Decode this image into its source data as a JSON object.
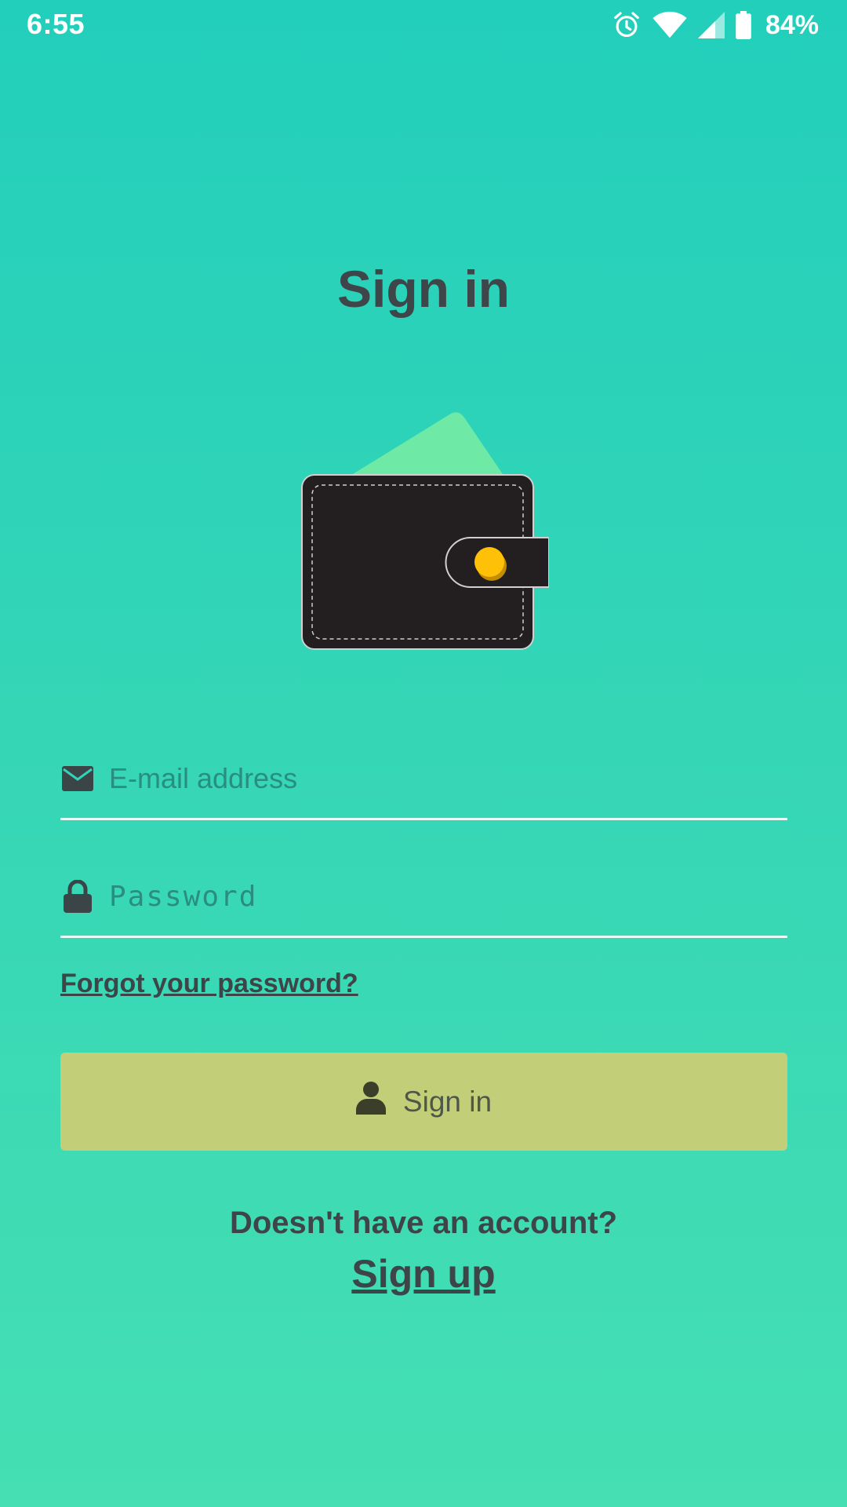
{
  "status_bar": {
    "time": "6:55",
    "battery": "84%",
    "icons": [
      "alarm-icon",
      "wifi-icon",
      "cell-signal-icon",
      "battery-icon"
    ]
  },
  "page": {
    "title": "Sign in",
    "illustration": "wallet-icon"
  },
  "form": {
    "email_placeholder": "E-mail address",
    "email_icon": "envelope-icon",
    "password_placeholder": "Password",
    "password_icon": "lock-icon",
    "forgot_password": "Forgot your password?",
    "signin_button": "Sign in",
    "signin_icon": "user-icon"
  },
  "footer": {
    "prompt": "Doesn't have an account?",
    "signup_link": "Sign up"
  },
  "colors": {
    "background_top": "#22cfbb",
    "background_bottom": "#45dfb3",
    "button": "#c3cf78",
    "text_dark": "#3e4649",
    "wallet": "#231f20",
    "wallet_button": "#ffc107",
    "card": "#6eeaa6"
  }
}
